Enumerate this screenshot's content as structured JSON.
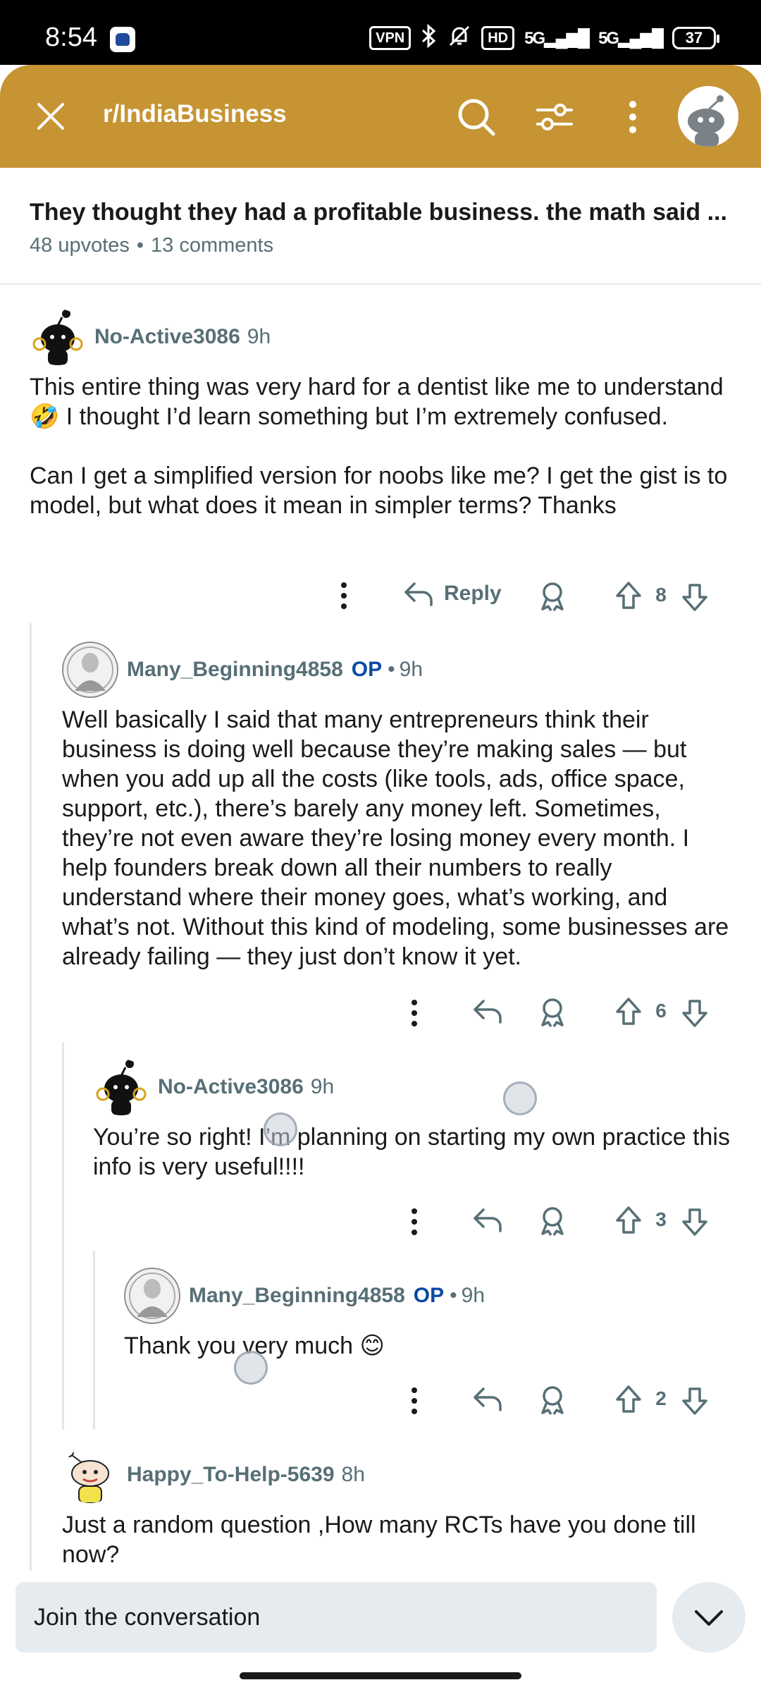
{
  "status_bar": {
    "time": "8:54",
    "vpn": "VPN",
    "hd": "HD",
    "net1": "5G",
    "net2": "5G",
    "battery": "37"
  },
  "top_bar": {
    "subreddit": "r/IndiaBusiness",
    "close_icon": "close-icon",
    "search_icon": "search-icon",
    "filter_icon": "sort-filter-icon",
    "more_icon": "more-vertical-icon",
    "avatar_icon": "snoo-avatar-icon",
    "color": "#c69433"
  },
  "post": {
    "title": "They thought they had a profitable business. the math said ...",
    "upvotes": "48 upvotes",
    "separator": "•",
    "comments": "13 comments"
  },
  "comments": [
    {
      "user": "No-Active3086",
      "time": "9h",
      "body": [
        "This entire thing was very hard for a dentist like me to understand 🤣 I thought I’d learn something but I’m extremely confused.",
        "Can I get a simplified version for noobs like me? I get the gist is to model, but what does it mean in simpler terms? Thanks"
      ],
      "reply_label": "Reply",
      "score": "8"
    },
    {
      "user": "Many_Beginning4858",
      "op": "OP",
      "sep": "•",
      "time": "9h",
      "body": [
        "Well basically I said that many entrepreneurs think their business is doing well because they’re making sales — but when you add up all the costs (like tools, ads, office space, support, etc.), there’s barely any money left. Sometimes, they’re not even aware they’re losing money every month. I help founders break down all their numbers to really understand where their money goes, what’s working, and what’s not. Without this kind of modeling, some businesses are already failing — they just don’t know it yet."
      ],
      "score": "6"
    },
    {
      "user": "No-Active3086",
      "time": "9h",
      "body": [
        "You’re so right! I’m planning on starting my own practice this info is very useful!!!!"
      ],
      "score": "3"
    },
    {
      "user": "Many_Beginning4858",
      "op": "OP",
      "sep": "•",
      "time": "9h",
      "body": [
        "Thank you very much 😊"
      ],
      "score": "2"
    },
    {
      "user": "Happy_To-Help-5639",
      "time": "8h",
      "body": [
        "Just a random question ,How many RCTs have you done till now?"
      ]
    }
  ],
  "bottom": {
    "join_placeholder": "Join the conversation",
    "collapse_icon": "chevron-down-icon"
  }
}
